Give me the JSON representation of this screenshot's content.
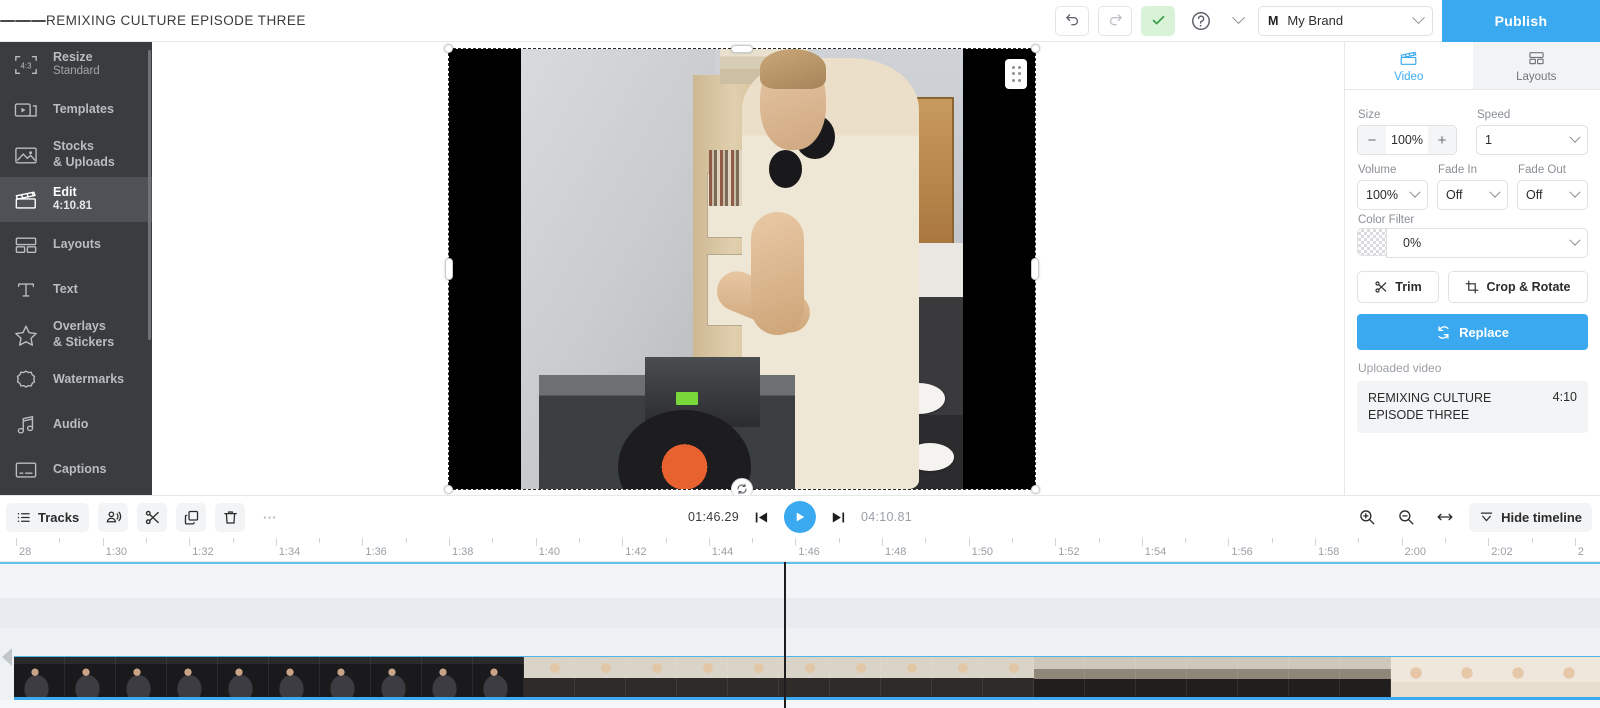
{
  "topbar": {
    "menu_icon": "hamburger-icon",
    "title": "REMIXING CULTURE EPISODE THREE",
    "undo_icon": "undo-icon",
    "redo_icon": "redo-icon",
    "saved_icon": "check-icon",
    "help_icon": "question-mark-icon",
    "help_chevron_icon": "chevron-down-icon",
    "brand_mark": "M",
    "brand_name": "My Brand",
    "brand_chevron_icon": "chevron-down-icon",
    "publish_label": "Publish"
  },
  "sidebar": {
    "items": [
      {
        "label": "Resize",
        "sub": "Standard",
        "icon": "resize-4-3-icon",
        "active": false
      },
      {
        "label": "Templates",
        "sub": "",
        "icon": "templates-icon",
        "active": false
      },
      {
        "label": "Stocks",
        "sub": "& Uploads",
        "icon": "image-icon",
        "active": false,
        "two_line": true
      },
      {
        "label": "Edit",
        "sub": "4:10.81",
        "icon": "clapperboard-icon",
        "active": true
      },
      {
        "label": "Layouts",
        "sub": "",
        "icon": "layouts-icon",
        "active": false
      },
      {
        "label": "Text",
        "sub": "",
        "icon": "text-t-icon",
        "active": false
      },
      {
        "label": "Overlays",
        "sub": "& Stickers",
        "icon": "star-icon",
        "active": false,
        "two_line": true
      },
      {
        "label": "Watermarks",
        "sub": "",
        "icon": "badge-seal-icon",
        "active": false
      },
      {
        "label": "Audio",
        "sub": "",
        "icon": "music-note-icon",
        "active": false
      },
      {
        "label": "Captions",
        "sub": "",
        "icon": "captions-icon",
        "active": false
      }
    ]
  },
  "canvas": {
    "selection_grip_icon": "drag-grip-icon",
    "rotate_icon": "rotate-handle-icon",
    "description": "Video preview: person with headphones at turntable and mixer in a kitchen, pillarboxed with black bars"
  },
  "panel": {
    "tabs": [
      {
        "label": "Video",
        "icon": "clapperboard-icon",
        "active": true
      },
      {
        "label": "Layouts",
        "icon": "layouts-icon",
        "active": false
      }
    ],
    "size_label": "Size",
    "size_value": "100%",
    "size_minus": "−",
    "size_plus": "+",
    "speed_label": "Speed",
    "speed_value": "1",
    "volume_label": "Volume",
    "volume_value": "100%",
    "fade_in_label": "Fade In",
    "fade_in_value": "Off",
    "fade_out_label": "Fade Out",
    "fade_out_value": "Off",
    "color_filter_label": "Color Filter",
    "color_filter_value": "0%",
    "trim_label": "Trim",
    "trim_icon": "scissors-icon",
    "crop_label": "Crop & Rotate",
    "crop_icon": "crop-icon",
    "replace_label": "Replace",
    "replace_icon": "refresh-icon",
    "uploaded_label": "Uploaded video",
    "uploaded_name": "REMIXING CULTURE EPISODE THREE",
    "uploaded_duration": "4:10"
  },
  "timeline_toolbar": {
    "tracks_label": "Tracks",
    "tracks_icon": "list-icon",
    "voiceover_icon": "voiceover-icon",
    "split_icon": "scissors-icon",
    "duplicate_icon": "copy-icon",
    "delete_icon": "trash-icon",
    "more_icon": "ellipsis-icon",
    "current_time": "01:46.29",
    "total_time": "04:10.81",
    "prev_icon": "skip-previous-icon",
    "play_icon": "play-icon",
    "next_icon": "skip-next-icon",
    "zoom_in_icon": "zoom-in-icon",
    "zoom_out_icon": "zoom-out-icon",
    "fit_icon": "fit-width-icon",
    "hide_timeline_label": "Hide timeline",
    "hide_timeline_icon": "collapse-down-icon"
  },
  "timeline": {
    "ruler_labels": [
      "28",
      "1:30",
      "1:32",
      "1:34",
      "1:36",
      "1:38",
      "1:40",
      "1:42",
      "1:44",
      "1:46",
      "1:48",
      "1:50",
      "1:52",
      "1:54",
      "1:56",
      "1:58",
      "2:00",
      "2:02",
      "2"
    ],
    "playhead_time": "1:46",
    "scroll_left_icon": "scroll-left-arrow-icon",
    "clip_name": "video-clip-track"
  }
}
